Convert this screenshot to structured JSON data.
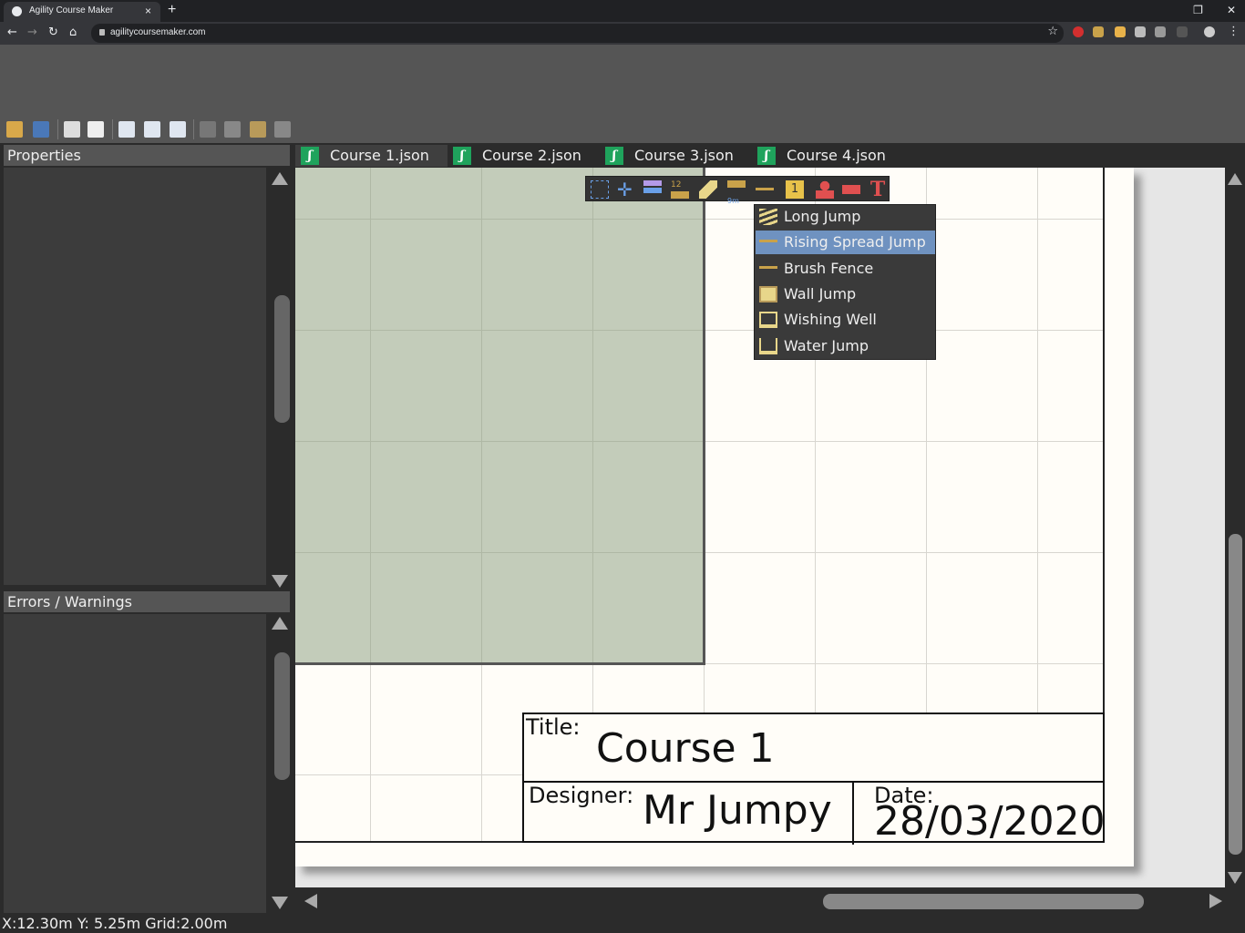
{
  "browser": {
    "tab_title": "Agility Course Maker",
    "tab_close": "×",
    "new_tab": "+",
    "url": "agilitycoursemaker.com",
    "window_controls": [
      "❐",
      "✕"
    ]
  },
  "panels": {
    "properties_title": "Properties",
    "errors_title": "Errors / Warnings"
  },
  "doc_tabs": [
    {
      "label": "Course 1.json",
      "active": true
    },
    {
      "label": "Course 2.json",
      "active": false
    },
    {
      "label": "Course 3.json",
      "active": false
    },
    {
      "label": "Course 4.json",
      "active": false
    }
  ],
  "jump_menu": {
    "items": [
      {
        "label": "Long Jump",
        "icon": "long-jump-icon"
      },
      {
        "label": "Rising Spread Jump",
        "icon": "rising-spread-jump-icon",
        "selected": true
      },
      {
        "label": "Brush Fence",
        "icon": "brush-fence-icon"
      },
      {
        "label": "Wall Jump",
        "icon": "wall-jump-icon"
      },
      {
        "label": "Wishing Well",
        "icon": "wishing-well-icon"
      },
      {
        "label": "Water Jump",
        "icon": "water-jump-icon"
      }
    ]
  },
  "popover_tools": {
    "weave_label": "12",
    "distance_label": "9m",
    "number_label": "1",
    "text_label": "T"
  },
  "title_block": {
    "title_label": "Title:",
    "title_value": "Course 1",
    "designer_label": "Designer:",
    "designer_value": "Mr Jumpy",
    "date_label": "Date:",
    "date_value": "28/03/2020"
  },
  "status_bar": "X:12.30m Y: 5.25m Grid:2.00m",
  "colors": {
    "accent_selected": "#6f92c0",
    "tab_icon_green": "#1fa35c",
    "paper": "#fffdf8",
    "selection": "#9aa58f"
  }
}
